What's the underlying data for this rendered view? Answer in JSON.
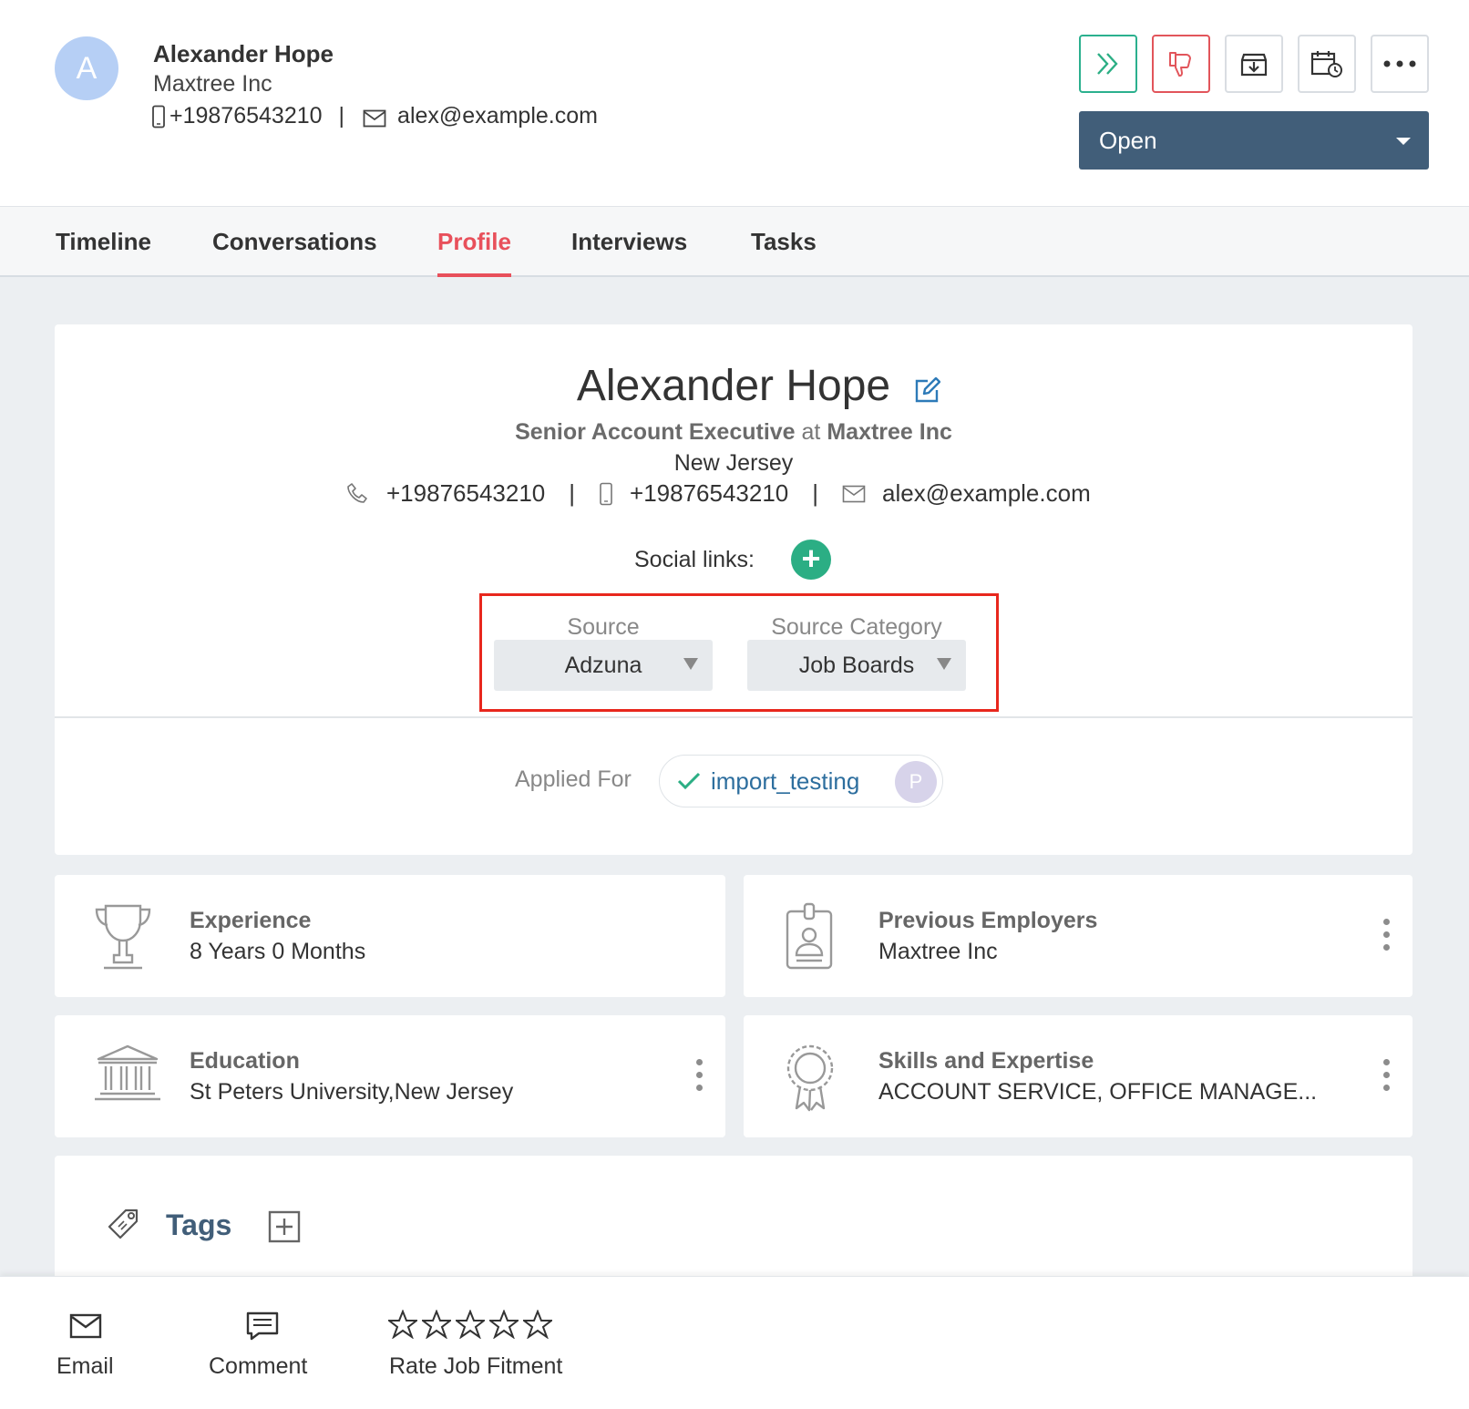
{
  "header": {
    "avatar_letter": "A",
    "name": "Alexander Hope",
    "company": "Maxtree Inc",
    "phone": "+19876543210",
    "separator": "|",
    "email": "alex@example.com",
    "status": "Open"
  },
  "tabs": [
    {
      "label": "Timeline"
    },
    {
      "label": "Conversations"
    },
    {
      "label": "Profile"
    },
    {
      "label": "Interviews"
    },
    {
      "label": "Tasks"
    }
  ],
  "active_tab": "Profile",
  "profile": {
    "name": "Alexander Hope",
    "job_title": "Senior Account Executive",
    "at": "at",
    "company": "Maxtree Inc",
    "location": "New Jersey",
    "phone": "+19876543210",
    "mobile": "+19876543210",
    "email": "alex@example.com",
    "separator": "|",
    "social_links_label": "Social links:",
    "social_add": "+",
    "source_label": "Source",
    "source_value": "Adzuna",
    "source_category_label": "Source Category",
    "source_category_value": "Job Boards",
    "applied_for_label": "Applied For",
    "applied_job": "import_testing",
    "applied_owner_initial": "P"
  },
  "info": {
    "experience": {
      "title": "Experience",
      "value": "8 Years 0 Months"
    },
    "employers": {
      "title": "Previous Employers",
      "value": "Maxtree Inc"
    },
    "education": {
      "title": "Education",
      "value": "St Peters University,New Jersey"
    },
    "skills": {
      "title": "Skills and Expertise",
      "value": "ACCOUNT SERVICE,  OFFICE MANAGE..."
    }
  },
  "tags": {
    "title": "Tags"
  },
  "bottom_bar": {
    "email": "Email",
    "comment": "Comment",
    "rate": "Rate Job Fitment",
    "rating": 0,
    "rating_max": 5
  },
  "colors": {
    "accent_red": "#e8505b",
    "status_bg": "#415e79",
    "green": "#2bae84",
    "highlight_box": "#e8271d"
  }
}
